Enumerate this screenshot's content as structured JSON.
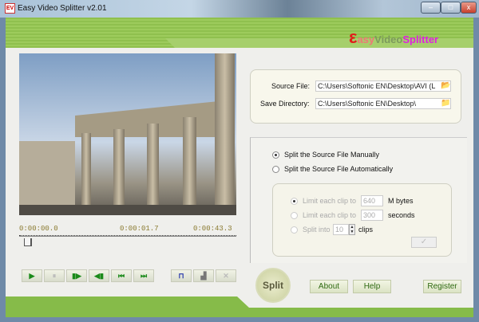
{
  "window": {
    "title": "Easy Video Splitter v2.01",
    "minimize": "–",
    "maximize": "□",
    "close": "x"
  },
  "logo": {
    "part1": "asy",
    "part2": "Video",
    "part3": "Splitter"
  },
  "player": {
    "time_start": "0:00:00.0",
    "time_current": "0:00:01.7",
    "time_end": "0:00:43.3",
    "position_fraction": 0.04
  },
  "controls": [
    {
      "name": "play",
      "glyph": "▶"
    },
    {
      "name": "pause",
      "glyph": "⏸"
    },
    {
      "name": "step-forward",
      "glyph": "▮▶"
    },
    {
      "name": "step-back",
      "glyph": "◀▮"
    },
    {
      "name": "go-start",
      "glyph": "⏮"
    },
    {
      "name": "go-end",
      "glyph": "⏭"
    }
  ],
  "marks": [
    {
      "name": "set-mark",
      "glyph": "⊓"
    },
    {
      "name": "mark-list",
      "glyph": "▟"
    },
    {
      "name": "delete-mark",
      "glyph": "✕"
    }
  ],
  "files": {
    "source_label": "Source File:",
    "source_value": "C:\\Users\\Softonic EN\\Desktop\\AVI (L",
    "save_label": "Save Directory:",
    "save_value": "C:\\Users\\Softonic EN\\Desktop\\"
  },
  "mode": {
    "manual": "Split the Source File Manually",
    "auto": "Split the Source File Automatically",
    "selected": "manual"
  },
  "auto": {
    "size_pre": "Limit each clip to",
    "size_value": "640",
    "size_unit": "M bytes",
    "time_pre": "Limit each clip to",
    "time_value": "300",
    "time_unit": "seconds",
    "count_pre": "Split into",
    "count_value": "10",
    "count_unit": "clips",
    "ok": "✓"
  },
  "buttons": {
    "split": "Split",
    "about": "About",
    "help": "Help",
    "register": "Register"
  }
}
